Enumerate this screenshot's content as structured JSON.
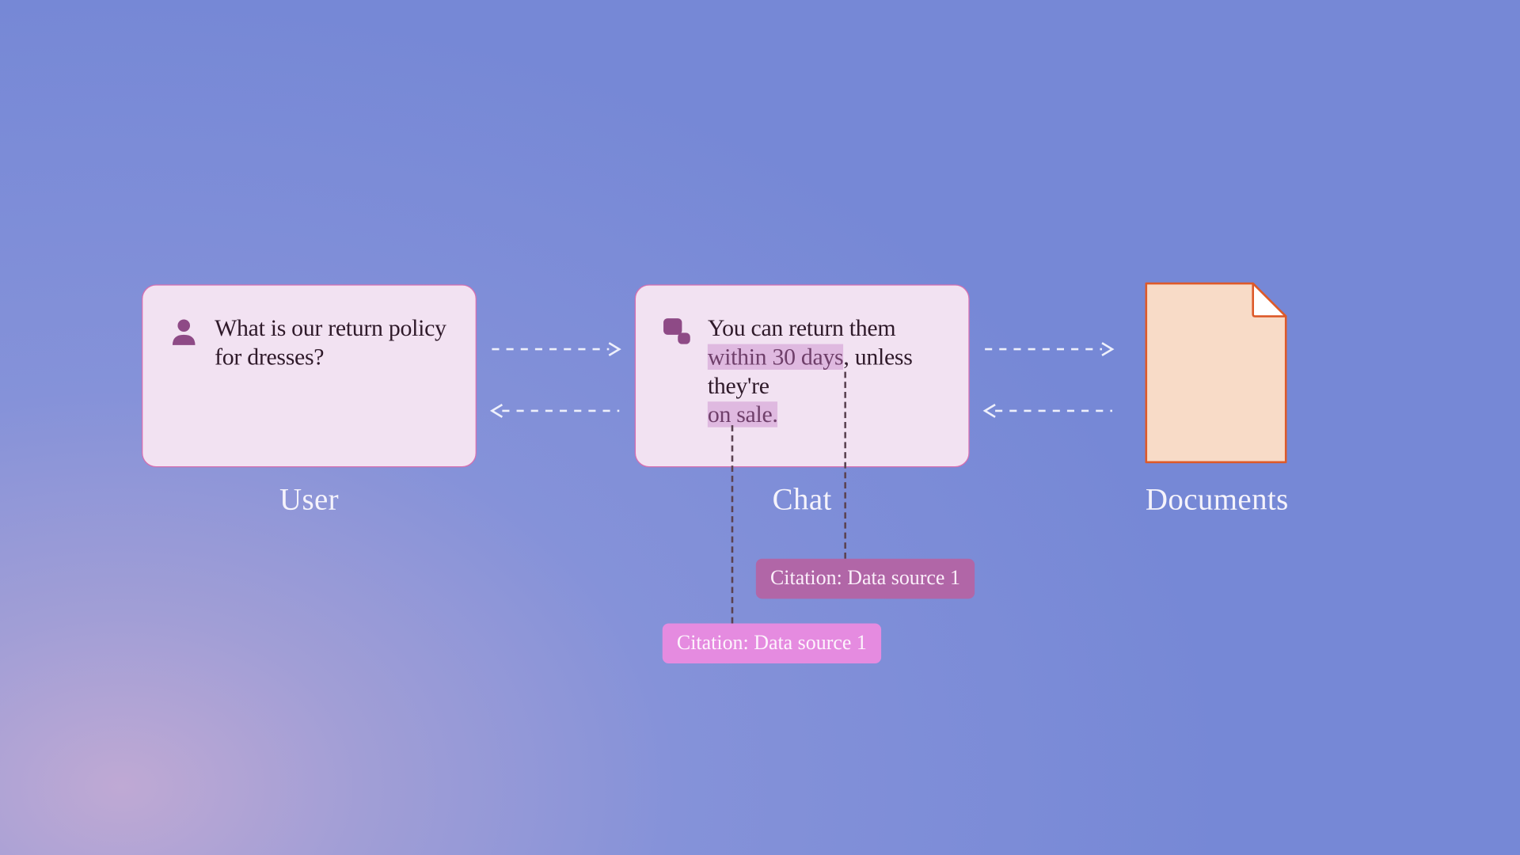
{
  "user": {
    "label": "User",
    "message": "What is our return policy for dresses?"
  },
  "chat": {
    "label": "Chat",
    "response_prefix": "You can return them ",
    "response_highlight_1": "within 30 days",
    "response_mid": ", unless they're ",
    "response_highlight_2": "on sale."
  },
  "documents": {
    "label": "Documents"
  },
  "citations": {
    "c1": "Citation: Data source 1",
    "c2": "Citation: Data source 1"
  }
}
